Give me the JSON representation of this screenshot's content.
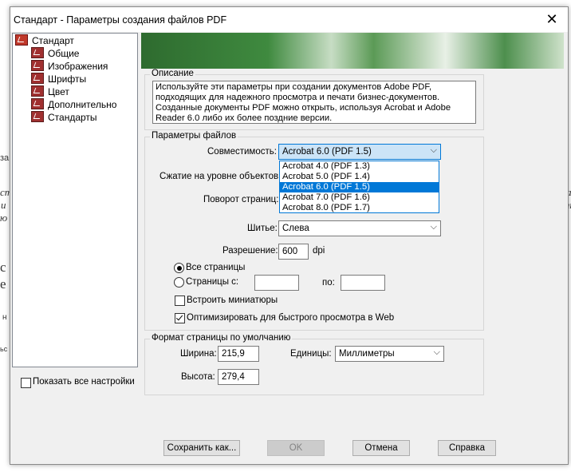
{
  "dialog": {
    "title": "Стандарт - Параметры создания файлов PDF",
    "close_glyph": "✕"
  },
  "tree": {
    "root": "Стандарт",
    "items": [
      "Общие",
      "Изображения",
      "Шрифты",
      "Цвет",
      "Дополнительно",
      "Стандарты"
    ]
  },
  "show_all": {
    "label": "Показать все настройки",
    "checked": false
  },
  "description": {
    "legend": "Описание",
    "text": "Используйте эти параметры при создании документов Adobe PDF, подходящих для надежного просмотра и печати бизнес-документов. Созданные документы PDF можно открыть, используя Acrobat и Adobe Reader 6.0 либо их более поздние версии."
  },
  "file_options": {
    "legend": "Параметры файлов",
    "compat_label": "Совместимость:",
    "compat_value": "Acrobat 6.0 (PDF 1.5)",
    "compat_options": [
      "Acrobat 4.0 (PDF 1.3)",
      "Acrobat 5.0 (PDF 1.4)",
      "Acrobat 6.0 (PDF 1.5)",
      "Acrobat 7.0 (PDF 1.6)",
      "Acrobat 8.0 (PDF 1.7)"
    ],
    "compat_selected_index": 2,
    "obj_compress_label": "Сжатие на уровне объектов:",
    "rotate_label": "Поворот страниц:",
    "binding_label": "Шитье:",
    "binding_value": "Слева",
    "resolution_label": "Разрешение:",
    "resolution_value": "600",
    "resolution_unit": "dpi",
    "all_pages_label": "Все страницы",
    "pages_from_label": "Страницы с:",
    "pages_to_label": "по:",
    "thumbnails_label": "Встроить миниатюры",
    "optimize_label": "Оптимизировать для быстрого просмотра в Web"
  },
  "page_size": {
    "legend": "Формат страницы по умолчанию",
    "width_label": "Ширина:",
    "width_value": "215,9",
    "units_label": "Единицы:",
    "units_value": "Миллиметры",
    "height_label": "Высота:",
    "height_value": "279,4"
  },
  "buttons": {
    "save_as": "Сохранить как...",
    "ok": "OK",
    "cancel": "Отмена",
    "help": "Справка"
  },
  "background_fragments": [
    "за",
    "ст",
    "и",
    "ю",
    "с",
    "е",
    "н",
    "ьс",
    "за",
    "ть"
  ]
}
